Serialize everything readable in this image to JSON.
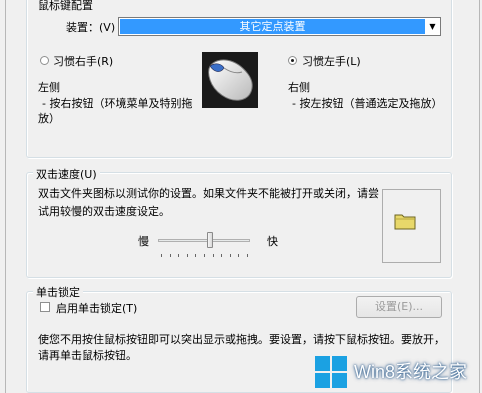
{
  "button_config": {
    "title": "鼠标键配置",
    "device_label": "装置：(V)",
    "device_value": "其它定点装置",
    "right_handed_label": "习惯右手(R)",
    "left_handed_label": "习惯左手(L)",
    "left_side_title": "左侧",
    "left_side_desc_line1": "- 按右按钮（环境菜单及特别拖",
    "left_side_desc_line2": "放）",
    "right_side_title": "右侧",
    "right_side_desc": "- 按左按钮（普通选定及拖放）",
    "selected": "left_handed"
  },
  "double_click": {
    "title": "双击速度(U)",
    "desc_line1": "双击文件夹图标以测试你的设置。如果文件夹不能被打开或关闭，请尝",
    "desc_line2": "试用较慢的双击速度设定。",
    "slow_label": "慢",
    "fast_label": "快",
    "speed_fraction": 0.6
  },
  "click_lock": {
    "title": "单击锁定",
    "checkbox_label": "启用单击锁定(T)",
    "checked": false,
    "settings_button": "设置(E)...",
    "desc_line1": "使您不用按住鼠标按钮即可以突出显示或拖拽。要设置，请按下鼠标按钮。要放开，",
    "desc_line2": "请再单击鼠标按钮。"
  },
  "watermark": {
    "text": "Win8系统之家"
  },
  "colors": {
    "selection": "#3399ff",
    "folder": "#e8d86a",
    "watermark_logo": "#1ba1e2"
  }
}
